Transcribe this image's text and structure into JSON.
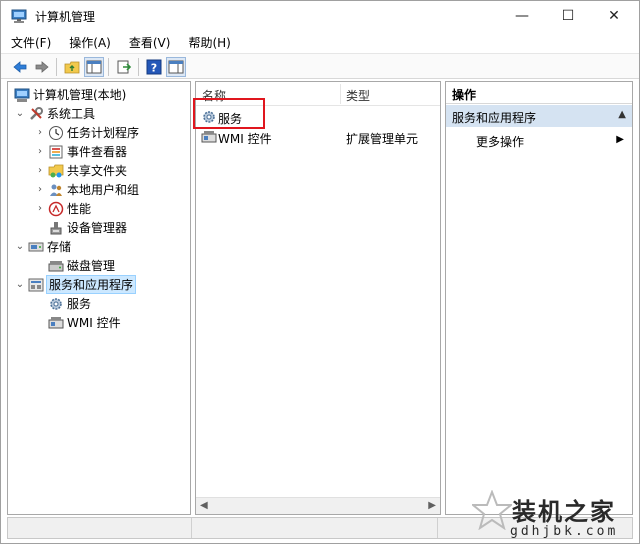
{
  "window": {
    "title": "计算机管理",
    "controls": {
      "minimize": "—",
      "maximize": "☐",
      "close": "✕"
    }
  },
  "menu": [
    "文件(F)",
    "操作(A)",
    "查看(V)",
    "帮助(H)"
  ],
  "toolbar": {
    "icons": [
      "back-arrow-icon",
      "forward-arrow-icon",
      "folder-up-icon",
      "console-tree-icon",
      "export-icon",
      "help-icon",
      "properties-icon"
    ]
  },
  "tree": {
    "root": "计算机管理(本地)",
    "system_tools": "系统工具",
    "task_scheduler": "任务计划程序",
    "event_viewer": "事件查看器",
    "shared_folders": "共享文件夹",
    "local_users": "本地用户和组",
    "performance": "性能",
    "device_manager": "设备管理器",
    "storage": "存储",
    "disk_management": "磁盘管理",
    "services_apps": "服务和应用程序",
    "services": "服务",
    "wmi": "WMI 控件"
  },
  "list": {
    "col_name": "名称",
    "col_type": "类型",
    "rows": [
      {
        "name": "服务",
        "type": ""
      },
      {
        "name": "WMI 控件",
        "type": "扩展管理单元"
      }
    ]
  },
  "actions": {
    "header": "操作",
    "section": "服务和应用程序",
    "more": "更多操作"
  },
  "watermark": {
    "text": "装机之家",
    "sub": "gdhjbk.com"
  },
  "colors": {
    "highlight": "#e0161e",
    "selection": "#cce8ff",
    "action_section": "#d5e3f2"
  }
}
